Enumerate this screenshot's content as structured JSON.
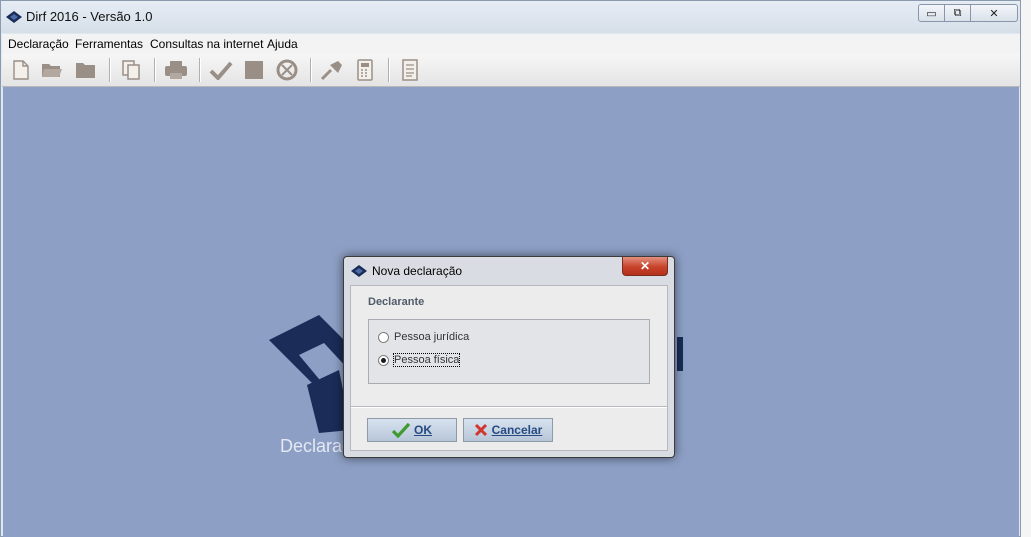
{
  "window": {
    "title": "Dirf 2016 - Versão 1.0",
    "controls": {
      "minimize": "▭",
      "maximize": "⧉",
      "close": "✕"
    }
  },
  "menu": {
    "items": [
      {
        "label": "Declaração"
      },
      {
        "label": "Ferramentas"
      },
      {
        "label": "Consultas na internet"
      },
      {
        "label": "Ajuda"
      }
    ]
  },
  "toolbar": {
    "icons": [
      "new-document-icon",
      "open-folder-icon",
      "folder-icon",
      "copy-icon",
      "print-icon",
      "check-icon",
      "square-icon",
      "recycle-icon",
      "transmit-icon",
      "calculator-icon",
      "report-icon"
    ]
  },
  "background": {
    "caption": "Declaraç"
  },
  "dialog": {
    "title": "Nova declaração",
    "close_label": "✕",
    "group_label": "Declarante",
    "options": [
      {
        "label": "Pessoa jurídica",
        "selected": false
      },
      {
        "label": "Pessoa física",
        "selected": true
      }
    ],
    "ok_label": "OK",
    "cancel_label": "Cancelar"
  },
  "colors": {
    "workspace": "#8d9fc5",
    "logo": "#1a2c57",
    "toolbar_icon": "#9a8f86"
  }
}
